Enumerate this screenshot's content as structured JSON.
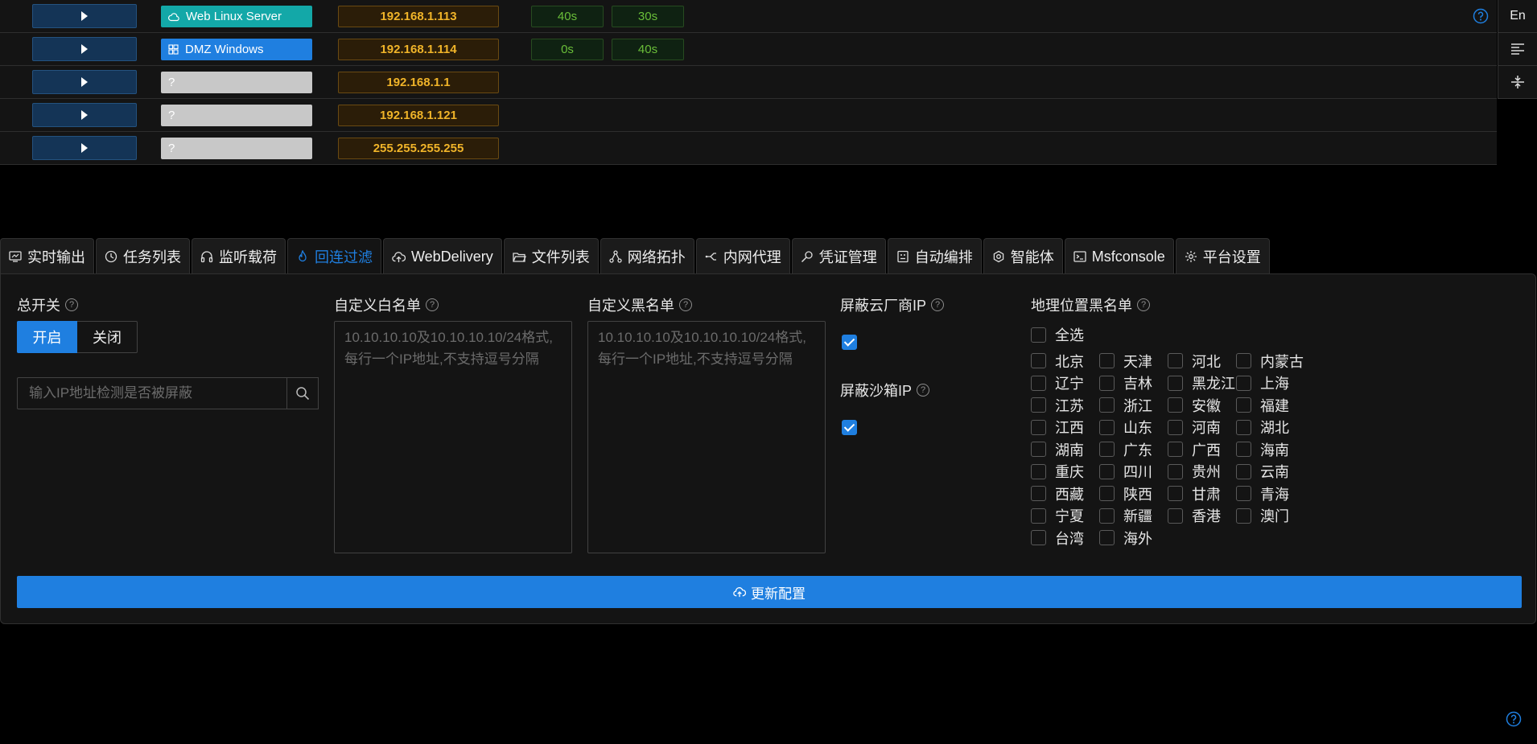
{
  "hosts": [
    {
      "tag": "Web Linux Server",
      "tag_icon": "cloud-icon",
      "tag_color": "#13a8a8",
      "ip": "192.168.1.113",
      "t1": "40s",
      "t2": "30s"
    },
    {
      "tag": "DMZ Windows",
      "tag_icon": "windows-icon",
      "tag_color": "#1f7fe0",
      "ip": "192.168.1.114",
      "t1": "0s",
      "t2": "40s"
    },
    {
      "tag": "?",
      "tag_icon": "",
      "tag_color": "#c8c8c8",
      "ip": "192.168.1.1"
    },
    {
      "tag": "?",
      "tag_icon": "",
      "tag_color": "#c8c8c8",
      "ip": "192.168.1.121"
    },
    {
      "tag": "?",
      "tag_icon": "",
      "tag_color": "#c8c8c8",
      "ip": "255.255.255.255"
    }
  ],
  "side": {
    "lang": "En"
  },
  "tabs": [
    {
      "label": "实时输出",
      "icon": "monitor-icon"
    },
    {
      "label": "任务列表",
      "icon": "clock-icon"
    },
    {
      "label": "监听载荷",
      "icon": "headphones-icon"
    },
    {
      "label": "回连过滤",
      "icon": "flame-icon",
      "active": true
    },
    {
      "label": "WebDelivery",
      "icon": "cloud-upload-icon"
    },
    {
      "label": "文件列表",
      "icon": "folder-icon"
    },
    {
      "label": "网络拓扑",
      "icon": "topology-icon"
    },
    {
      "label": "内网代理",
      "icon": "proxy-icon"
    },
    {
      "label": "凭证管理",
      "icon": "key-icon"
    },
    {
      "label": "自动编排",
      "icon": "robot-icon"
    },
    {
      "label": "智能体",
      "icon": "agent-icon"
    },
    {
      "label": "Msfconsole",
      "icon": "terminal-icon"
    },
    {
      "label": "平台设置",
      "icon": "gear-icon"
    }
  ],
  "filter": {
    "switch_label": "总开关",
    "switch_on": "开启",
    "switch_off": "关闭",
    "ip_check_placeholder": "输入IP地址检测是否被屏蔽",
    "whitelist_label": "自定义白名单",
    "whitelist_placeholder": "10.10.10.10及10.10.10.10/24格式,每行一个IP地址,不支持逗号分隔",
    "blacklist_label": "自定义黑名单",
    "blacklist_placeholder": "10.10.10.10及10.10.10.10/24格式,每行一个IP地址,不支持逗号分隔",
    "cloud_label": "屏蔽云厂商IP",
    "cloud_checked": true,
    "sandbox_label": "屏蔽沙箱IP",
    "sandbox_checked": true,
    "geo_label": "地理位置黑名单",
    "geo_all": "全选",
    "regions": [
      "北京",
      "天津",
      "河北",
      "内蒙古",
      "辽宁",
      "吉林",
      "黑龙江",
      "上海",
      "江苏",
      "浙江",
      "安徽",
      "福建",
      "江西",
      "山东",
      "河南",
      "湖北",
      "湖南",
      "广东",
      "广西",
      "海南",
      "重庆",
      "四川",
      "贵州",
      "云南",
      "西藏",
      "陕西",
      "甘肃",
      "青海",
      "宁夏",
      "新疆",
      "香港",
      "澳门",
      "台湾",
      "海外"
    ],
    "update_button": "更新配置"
  },
  "colors": {
    "accent": "#1f7fe0",
    "ip_text": "#f0b429",
    "time_text": "#6abe39"
  }
}
